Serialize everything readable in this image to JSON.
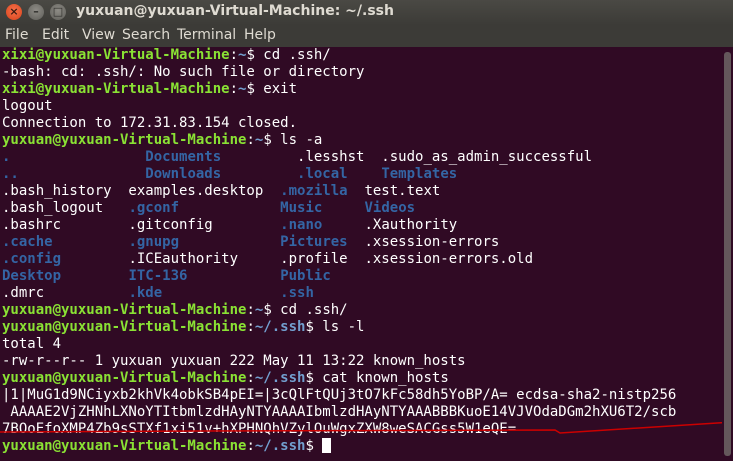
{
  "window": {
    "title": "yuxuan@yuxuan-Virtual-Machine: ~/.ssh",
    "close_glyph": "×",
    "min_glyph": "–",
    "max_glyph": "□"
  },
  "menu": [
    "File",
    "Edit",
    "View",
    "Search",
    "Terminal",
    "Help"
  ],
  "colors": {
    "background": "#300a24",
    "prompt_user": "#8ae234",
    "prompt_path": "#729fcf",
    "directory": "#3465a4",
    "annotation_line": "#cc0000"
  },
  "terminal": {
    "lines": [
      [
        {
          "t": "xixi@yuxuan-Virtual-Machine",
          "c": "pu"
        },
        {
          "t": ":",
          "c": ""
        },
        {
          "t": "~",
          "c": "pd"
        },
        {
          "t": "$ cd .ssh/",
          "c": ""
        }
      ],
      [
        {
          "t": "-bash: cd: .ssh/: No such file or directory",
          "c": ""
        }
      ],
      [
        {
          "t": "xixi@yuxuan-Virtual-Machine",
          "c": "pu"
        },
        {
          "t": ":",
          "c": ""
        },
        {
          "t": "~",
          "c": "pd"
        },
        {
          "t": "$ exit",
          "c": ""
        }
      ],
      [
        {
          "t": "logout",
          "c": ""
        }
      ],
      [
        {
          "t": "Connection to 172.31.83.154 closed.",
          "c": ""
        }
      ],
      [
        {
          "t": "yuxuan@yuxuan-Virtual-Machine",
          "c": "pu"
        },
        {
          "t": ":",
          "c": ""
        },
        {
          "t": "~",
          "c": "pd"
        },
        {
          "t": "$ ls -a",
          "c": ""
        }
      ],
      [
        {
          "t": ".",
          "c": "dir"
        },
        {
          "t": "                ",
          "c": ""
        },
        {
          "t": "Documents",
          "c": "dir"
        },
        {
          "t": "         .lesshst  .sudo_as_admin_successful",
          "c": ""
        }
      ],
      [
        {
          "t": "..",
          "c": "dir"
        },
        {
          "t": "               ",
          "c": ""
        },
        {
          "t": "Downloads",
          "c": "dir"
        },
        {
          "t": "         ",
          "c": ""
        },
        {
          "t": ".local",
          "c": "dir"
        },
        {
          "t": "    ",
          "c": ""
        },
        {
          "t": "Templates",
          "c": "dir"
        }
      ],
      [
        {
          "t": ".bash_history  examples.desktop  ",
          "c": ""
        },
        {
          "t": ".mozilla",
          "c": "dir"
        },
        {
          "t": "  test.text",
          "c": ""
        }
      ],
      [
        {
          "t": ".bash_logout   ",
          "c": ""
        },
        {
          "t": ".gconf",
          "c": "dir"
        },
        {
          "t": "            ",
          "c": ""
        },
        {
          "t": "Music",
          "c": "dir"
        },
        {
          "t": "     ",
          "c": ""
        },
        {
          "t": "Videos",
          "c": "dir"
        }
      ],
      [
        {
          "t": ".bashrc        .gitconfig        ",
          "c": ""
        },
        {
          "t": ".nano",
          "c": "dir"
        },
        {
          "t": "     .Xauthority",
          "c": ""
        }
      ],
      [
        {
          "t": ".cache",
          "c": "dir"
        },
        {
          "t": "         ",
          "c": ""
        },
        {
          "t": ".gnupg",
          "c": "dir"
        },
        {
          "t": "            ",
          "c": ""
        },
        {
          "t": "Pictures",
          "c": "dir"
        },
        {
          "t": "  .xsession-errors",
          "c": ""
        }
      ],
      [
        {
          "t": ".config",
          "c": "dir"
        },
        {
          "t": "        .ICEauthority     .profile  .xsession-errors.old",
          "c": ""
        }
      ],
      [
        {
          "t": "Desktop",
          "c": "dir"
        },
        {
          "t": "        ",
          "c": ""
        },
        {
          "t": "ITC-136",
          "c": "dir"
        },
        {
          "t": "           ",
          "c": ""
        },
        {
          "t": "Public",
          "c": "dir"
        }
      ],
      [
        {
          "t": ".dmrc          ",
          "c": ""
        },
        {
          "t": ".kde",
          "c": "dir"
        },
        {
          "t": "              ",
          "c": ""
        },
        {
          "t": ".ssh",
          "c": "dir"
        }
      ],
      [
        {
          "t": "yuxuan@yuxuan-Virtual-Machine",
          "c": "pu"
        },
        {
          "t": ":",
          "c": ""
        },
        {
          "t": "~",
          "c": "pd"
        },
        {
          "t": "$ cd .ssh/",
          "c": ""
        }
      ],
      [
        {
          "t": "yuxuan@yuxuan-Virtual-Machine",
          "c": "pu"
        },
        {
          "t": ":",
          "c": ""
        },
        {
          "t": "~/.ssh",
          "c": "pd"
        },
        {
          "t": "$ ls -l",
          "c": ""
        }
      ],
      [
        {
          "t": "total 4",
          "c": ""
        }
      ],
      [
        {
          "t": "-rw-r--r-- 1 yuxuan yuxuan 222 May 11 13:22 known_hosts",
          "c": ""
        }
      ],
      [
        {
          "t": "yuxuan@yuxuan-Virtual-Machine",
          "c": "pu"
        },
        {
          "t": ":",
          "c": ""
        },
        {
          "t": "~/.ssh",
          "c": "pd"
        },
        {
          "t": "$ cat known_hosts",
          "c": ""
        }
      ],
      [
        {
          "t": "|1|MuG1d9NCiyxb2khVk4obkSB4pEI=|3cQlFtQUj3tO7kFc58dh5YoBP/A= ecdsa-sha2-nistp256",
          "c": ""
        }
      ],
      [
        {
          "t": " AAAAE2VjZHNhLXNoYTItbmlzdHAyNTYAAAAIbmlzdHAyNTYAAABBBKuoE14VJVOdaDGm2hXU6T2/scb",
          "c": ""
        }
      ],
      [
        {
          "t": "7BOoEfoXMP4Zb9sSTXf1xi51v+hXPHNQhVZylOuWgxZXW8weSACGss5W1eQE=",
          "c": ""
        }
      ],
      [
        {
          "t": "yuxuan@yuxuan-Virtual-Machine",
          "c": "pu"
        },
        {
          "t": ":",
          "c": ""
        },
        {
          "t": "~/.ssh",
          "c": "pd"
        },
        {
          "t": "$ ",
          "c": ""
        }
      ]
    ]
  }
}
